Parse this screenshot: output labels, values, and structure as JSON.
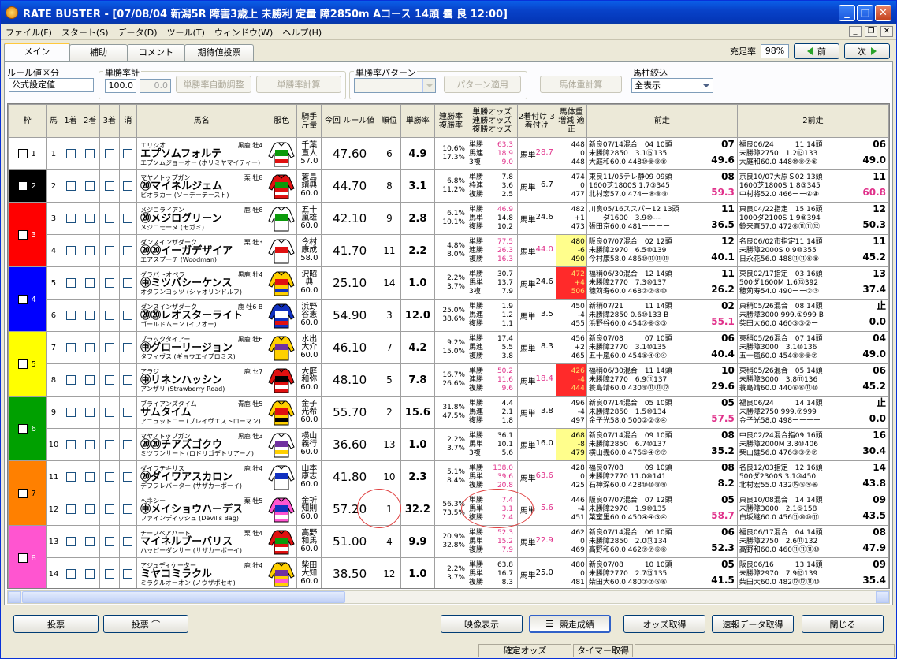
{
  "window": {
    "title": "RATE BUSTER - [07/08/04 新潟5R 障害3歳上 未勝利 定量 障2850m Aコース 14頭 曇 良 12:00]",
    "min": "_",
    "max": "□",
    "close": "✕"
  },
  "menu": [
    "ファイル(F)",
    "スタート(S)",
    "データ(D)",
    "ツール(T)",
    "ウィンドウ(W)",
    "ヘルプ(H)"
  ],
  "tabs": [
    "メイン",
    "補助",
    "コメント",
    "期待値投票"
  ],
  "fill_rate": {
    "label": "充足率",
    "value": "98%"
  },
  "nav": {
    "prev": "前",
    "next": "次"
  },
  "controls": {
    "rule_label": "ルール値区分",
    "rule_value": "公式設定値",
    "winrate_total_label": "単勝率計",
    "winrate_total_value": "100.0",
    "winrate_total_value2": "0.0",
    "auto_adjust": "単勝率自動調整",
    "calc": "単勝率計算",
    "pattern_label": "単勝率パターン",
    "pattern_apply": "パターン適用",
    "weight_calc": "馬体重計算",
    "filter_label": "馬柱絞込",
    "filter_value": "全表示"
  },
  "headers": {
    "waku": "枠",
    "uma": "馬",
    "c1": "1着",
    "c2": "2着",
    "c3": "3着",
    "kesu": "消",
    "name": "馬名",
    "silks": "服色",
    "jockey": "騎手 斤量",
    "rule": "今回 ルール値",
    "rank": "順位",
    "winrate": "単勝率",
    "renrate": "連勝率 複勝率",
    "odds": "単勝オッズ 連勝オッズ 複勝オッズ",
    "ticket": "2着付け 3着付け",
    "body": "馬体重 増減 適正",
    "prev1": "前走",
    "prev2": "2前走"
  },
  "waku_colors": [
    "#ffffff",
    "#000000",
    "#ff0000",
    "#0000ff",
    "#ffff00",
    "#00a000",
    "#ff8000",
    "#ff55d0"
  ],
  "waku_groups": [
    {
      "label": "1",
      "rows": 1,
      "color": "#ffffff",
      "text": "#000000"
    },
    {
      "label": "2",
      "rows": 1,
      "color": "#000000",
      "text": "#ffffff"
    },
    {
      "label": "3",
      "rows": 2,
      "color": "#ff0000",
      "text": "#ffffff"
    },
    {
      "label": "4",
      "rows": 2,
      "color": "#0000ff",
      "text": "#ffffff"
    },
    {
      "label": "5",
      "rows": 2,
      "color": "#ffff00",
      "text": "#000000"
    },
    {
      "label": "6",
      "rows": 2,
      "color": "#00a000",
      "text": "#ffffff"
    },
    {
      "label": "7",
      "rows": 2,
      "color": "#ff8000",
      "text": "#000000"
    },
    {
      "label": "8",
      "rows": 2,
      "color": "#ff55d0",
      "text": "#ffffff"
    }
  ],
  "horses": [
    {
      "no": "1",
      "sire": "エリシオ",
      "meta": "黒鹿 牡4",
      "name": "エプソムフォルテ",
      "dam": "エプソムジョーオー (ホリミヤマイティー)",
      "jockey": [
        "千葉",
        "直人",
        "57.0"
      ],
      "rule": "47.60",
      "rank": "6",
      "winrate": "4.9",
      "rate": [
        "10.6%",
        "17.3%",
        ""
      ],
      "odds": [
        [
          "単勝",
          "63.3"
        ],
        [
          "馬連",
          "18.9"
        ],
        [
          "3複",
          "9.0"
        ]
      ],
      "odds_colors": [
        "#e0308a",
        "#e0308a",
        "#e0308a"
      ],
      "ticket": "馬単",
      "ticket_val": "28.7",
      "ticket_pink": true,
      "body": [
        "448",
        "0",
        "448"
      ],
      "body_style": "",
      "silk": [
        "#ffffff",
        "#0a9a0a",
        "#e01010"
      ],
      "p1": [
        "新良07/14混合　04 10頭",
        "未勝障2850　3.1⑮135",
        "大庭和60.0 448⑩⑨⑨⑧"
      ],
      "p1r": [
        "07",
        "49.6"
      ],
      "p2": [
        "福良06/24　　　11 14頭",
        "未勝障2750　1.2⑬133",
        "大庭和60.0 448⑩⑨⑦⑥"
      ],
      "p2r": [
        "06",
        "49.0"
      ]
    },
    {
      "no": "2",
      "sire": "マヤノトップガン",
      "meta": "栗 牡8",
      "name": "⑳マイネルジェム",
      "dam": "ビオラカー (ソーデーテースト)",
      "jockey": [
        "蓑島",
        "靖典",
        "60.0"
      ],
      "rule": "44.70",
      "rank": "8",
      "winrate": "3.1",
      "rate": [
        "6.8%",
        "11.2%",
        ""
      ],
      "odds": [
        [
          "単勝",
          "7.8"
        ],
        [
          "枠連",
          "3.6"
        ],
        [
          "複勝",
          "2.5"
        ]
      ],
      "odds_colors": [
        "",
        "",
        ""
      ],
      "ticket": "馬単",
      "ticket_val": "6.7",
      "ticket_pink": false,
      "body": [
        "474",
        "0",
        "477"
      ],
      "body_style": "",
      "silk": [
        "#e01010",
        "#0a9a0a",
        "#ffffff"
      ],
      "p1": [
        "東良11/05テレ静09 09頭",
        "1600芝1800S 1.7③345",
        "北村宏57.0 474ー⑧⑨⑨"
      ],
      "p1r": [
        "08",
        "59.3"
      ],
      "p2": [
        "京良10/07大原Ｓ02 13頭",
        "1600芝1800S 1.8③345",
        "中村将52.0 466ーー④④"
      ],
      "p2r": [
        "11",
        "60.8"
      ]
    },
    {
      "no": "3",
      "sire": "メジロライアン",
      "meta": "鹿 牡8",
      "name": "⑳メジログリーン",
      "dam": "メジロモーヌ (モガミ)",
      "jockey": [
        "五十",
        "嵐雄",
        "60.0"
      ],
      "rule": "42.10",
      "rank": "9",
      "winrate": "2.8",
      "rate": [
        "6.1%",
        "10.1%",
        ""
      ],
      "odds": [
        [
          "単勝",
          "46.9"
        ],
        [
          "馬単",
          "14.8"
        ],
        [
          "複勝",
          "10.2"
        ]
      ],
      "odds_colors": [
        "#e0308a",
        "",
        ""
      ],
      "ticket": "馬単",
      "ticket_val": "24.6",
      "ticket_pink": false,
      "body": [
        "482",
        "+1",
        "473"
      ],
      "body_style": "",
      "silk": [
        "#ffffff",
        "#0a9a0a",
        "#ffffff"
      ],
      "p1": [
        "川良05/16ススパー12 13頭",
        "　　ダ1600　3.9⑩---",
        "張田京60.0 481ーーーー"
      ],
      "p1r": [
        "11",
        "36.5"
      ],
      "p2": [
        "東良04/22指定　15 16頭",
        "1000ダ2100S 1.9⑧394",
        "鈴来直57.0 472⑥⑪⑪⑫"
      ],
      "p2r": [
        "12",
        "50.3"
      ]
    },
    {
      "no": "4",
      "sire": "ダンスインザダーク",
      "meta": "栗 牡3",
      "name": "⑳⑳イーガデザイア",
      "dam": "エアスプーチ (Woodman)",
      "jockey": [
        "今村",
        "康成",
        "58.0"
      ],
      "rule": "41.70",
      "rank": "11",
      "winrate": "2.2",
      "rate": [
        "4.8%",
        "8.0%",
        ""
      ],
      "odds": [
        [
          "単勝",
          "77.5"
        ],
        [
          "連勝",
          "26.3"
        ],
        [
          "複勝",
          "16.3"
        ]
      ],
      "odds_colors": [
        "#e0308a",
        "#e0308a",
        "#e0308a"
      ],
      "ticket": "馬単",
      "ticket_val": "44.0",
      "ticket_pink": true,
      "body": [
        "480",
        "-6",
        "490"
      ],
      "body_style": "yel",
      "silk": [
        "#ffffff",
        "#e01010",
        "#ffffff"
      ],
      "p1": [
        "阪良07/07混合　02 12頭",
        "未勝障2970　6.5⑩139",
        "今村康58.0 486⑩⑪⑪⑪"
      ],
      "p1r": [
        "12",
        "40.1"
      ],
      "p2": [
        "名良06/02市指定11 14頭",
        "未勝障2000S 0.9⑩355",
        "日永花56.0 488⑪⑪⑥⑧"
      ],
      "p2r": [
        "11",
        "45.2"
      ]
    },
    {
      "no": "5",
      "sire": "グラバトオペラ",
      "meta": "黒鹿 牡4",
      "name": "㊥ミツバシーケンス",
      "dam": "オタワンヨッツ (シャオリンドルフ)",
      "jockey": [
        "沢昭",
        "典",
        "60.0"
      ],
      "rule": "25.10",
      "rank": "14",
      "winrate": "1.0",
      "rate": [
        "2.2%",
        "3.7%",
        ""
      ],
      "odds": [
        [
          "単勝",
          "30.7"
        ],
        [
          "馬単",
          "13.7"
        ],
        [
          "3複",
          "7.9"
        ]
      ],
      "odds_colors": [
        "",
        "",
        ""
      ],
      "ticket": "馬単",
      "ticket_val": "24.6",
      "ticket_pink": false,
      "body": [
        "472",
        "+4",
        "506"
      ],
      "body_style": "red",
      "silk": [
        "#ffd000",
        "#e01010",
        "#1030c0"
      ],
      "p1": [
        "福稍06/30混合　12 14頭",
        "未勝障2770　7.3⑩137",
        "穂苅寿60.0 468②②⑧⑩"
      ],
      "p1r": [
        "11",
        "26.2"
      ],
      "p2": [
        "東良02/17指定　03 16頭",
        "500ダ1600M 1.6⑬392",
        "穂苅寿54.0 490ーー②③"
      ],
      "p2r": [
        "13",
        "37.4"
      ]
    },
    {
      "no": "6",
      "sire": "ダンスインザダーク",
      "meta": "鹿 牡6 B",
      "name": "⑳⑳レオスターライト",
      "dam": "ゴールドムーン (イフオー)",
      "jockey": [
        "浜野",
        "谷憲",
        "60.0"
      ],
      "rule": "54.90",
      "rank": "3",
      "winrate": "12.0",
      "rate": [
        "25.0%",
        "38.6%",
        ""
      ],
      "odds": [
        [
          "単勝",
          "1.9"
        ],
        [
          "馬連",
          "1.2"
        ],
        [
          "複勝",
          "1.1"
        ]
      ],
      "odds_colors": [
        "",
        "",
        ""
      ],
      "ticket": "馬単",
      "ticket_val": "3.5",
      "ticket_pink": false,
      "body": [
        "450",
        "-4",
        "455"
      ],
      "body_style": "",
      "silk": [
        "#1030c0",
        "#ffffff",
        "#e01010"
      ],
      "p1": [
        "新稍07/21　　　11 14頭",
        "未勝障2850 0.6⑩133 B",
        "浜野谷60.0 454⑦⑥⑤③"
      ],
      "p1r": [
        "02",
        "55.1"
      ],
      "p2": [
        "東稍05/26混合　08 14頭",
        "未勝障3000 999.①999 B",
        "柴田大60.0 460③③②ー"
      ],
      "p2r": [
        "止",
        "0.0"
      ]
    },
    {
      "no": "7",
      "sire": "ブラックタイアー",
      "meta": "黒鹿 牡6",
      "name": "㊥グローリージョン",
      "dam": "タフィヴス (ギョウエイプロミス)",
      "jockey": [
        "水出",
        "大介",
        "60.0"
      ],
      "rule": "46.10",
      "rank": "7",
      "winrate": "4.2",
      "rate": [
        "9.2%",
        "15.0%",
        ""
      ],
      "odds": [
        [
          "単勝",
          "17.4"
        ],
        [
          "馬連",
          "5.5"
        ],
        [
          "複勝",
          "3.8"
        ]
      ],
      "odds_colors": [
        "",
        "",
        ""
      ],
      "ticket": "馬単",
      "ticket_val": "8.3",
      "ticket_pink": false,
      "body": [
        "456",
        "+2",
        "465"
      ],
      "body_style": "",
      "silk": [
        "#ffd000",
        "#7030a0",
        "#ffd000"
      ],
      "p1": [
        "新良07/08　　　07 10頭",
        "未勝障2770　3.1⑩135",
        "五十嵐60.0 454⑤④④④"
      ],
      "p1r": [
        "06",
        "40.4"
      ],
      "p2": [
        "東稍05/26混合　07 14頭",
        "未勝障3000　3.1⑩136",
        "五十嵐60.0 454⑧⑨⑨⑦"
      ],
      "p2r": [
        "04",
        "49.0"
      ]
    },
    {
      "no": "8",
      "sire": "アラジ",
      "meta": "鹿 セ7",
      "name": "㊥リネンハッシン",
      "dam": "アンザリ (Strawberry Road)",
      "jockey": [
        "大庭",
        "和弥",
        "60.0"
      ],
      "rule": "48.10",
      "rank": "5",
      "winrate": "7.8",
      "rate": [
        "16.7%",
        "26.6%",
        ""
      ],
      "odds": [
        [
          "単勝",
          "50.2"
        ],
        [
          "連勝",
          "11.6"
        ],
        [
          "複勝",
          "9.6"
        ]
      ],
      "odds_colors": [
        "#e0308a",
        "#e0308a",
        "#e0308a"
      ],
      "ticket": "馬単",
      "ticket_val": "18.4",
      "ticket_pink": true,
      "body": [
        "426",
        "-4",
        "444"
      ],
      "body_style": "red",
      "silk": [
        "#e01010",
        "#000000",
        "#ffffff"
      ],
      "p1": [
        "福稍06/30混合　11 14頭",
        "未勝障2770　6.9⑪137",
        "蓑島靖60.0 430⑨⑪⑪⑫"
      ],
      "p1r": [
        "10",
        "29.6"
      ],
      "p2": [
        "東稍05/26混合　05 14頭",
        "未勝障3000　3.8⑪136",
        "蓑島靖60.0 440⑥⑥⑪⑩"
      ],
      "p2r": [
        "06",
        "45.2"
      ]
    },
    {
      "no": "9",
      "sire": "ブライアンズタイム",
      "meta": "青鹿 牡5",
      "name": "サムタイム",
      "dam": "アニュットロー (プレイヴエストローマン)",
      "jockey": [
        "金子",
        "光希",
        "60.0"
      ],
      "rule": "55.70",
      "rank": "2",
      "winrate": "15.6",
      "rate": [
        "31.8%",
        "47.5%",
        ""
      ],
      "odds": [
        [
          "単勝",
          "4.4"
        ],
        [
          "馬連",
          "2.1"
        ],
        [
          "複勝",
          "1.8"
        ]
      ],
      "odds_colors": [
        "",
        "",
        ""
      ],
      "ticket": "馬単",
      "ticket_val": "3.8",
      "ticket_pink": false,
      "body": [
        "496",
        "-4",
        "497"
      ],
      "body_style": "",
      "silk": [
        "#ffd000",
        "#e01010",
        "#000000"
      ],
      "p1": [
        "新良07/14混合　05 10頭",
        "未勝障2850　1.5⑩134",
        "金子光58.0 500②②⑨④"
      ],
      "p1r": [
        "05",
        "57.5"
      ],
      "p2": [
        "福良06/24　　　14 14頭",
        "未勝障2750 999.⑦999",
        "金子光58.0 498ーーーー"
      ],
      "p2r": [
        "止",
        "0.0"
      ]
    },
    {
      "no": "10",
      "sire": "マヤノトップガン",
      "meta": "黒鹿 牡3",
      "name": "⑳⑳チアズゴクウ",
      "dam": "ミツワンサート (ロドリゴデトリアーノ)",
      "jockey": [
        "横山",
        "義行",
        "60.0"
      ],
      "rule": "36.60",
      "rank": "13",
      "winrate": "1.0",
      "rate": [
        "2.2%",
        "3.7%",
        ""
      ],
      "odds": [
        [
          "単勝",
          "36.1"
        ],
        [
          "馬単",
          "10.1"
        ],
        [
          "3複",
          "5.6"
        ]
      ],
      "odds_colors": [
        "",
        "",
        ""
      ],
      "ticket": "馬単",
      "ticket_val": "16.0",
      "ticket_pink": false,
      "body": [
        "468",
        "-8",
        "479"
      ],
      "body_style": "yel",
      "silk": [
        "#ffffff",
        "#7030a0",
        "#ffd000"
      ],
      "p1": [
        "新良07/14混合　09 10頭",
        "未勝障2850　6.7⑩137",
        "横山義60.0 476⑤④⑦⑦"
      ],
      "p1r": [
        "08",
        "35.2"
      ],
      "p2": [
        "中良02/24混合指09 16頭",
        "未勝障2000M 3.8⑩406",
        "柴山雄56.0 476③③⑦⑦"
      ],
      "p2r": [
        "16",
        "30.4"
      ]
    },
    {
      "no": "11",
      "sire": "ダイワテキサス",
      "meta": "鹿 牡4",
      "name": "⑳ダイワアスカロン",
      "dam": "デフフレバーター (サザカーボーイ)",
      "jockey": [
        "山本",
        "康志",
        "60.0"
      ],
      "rule": "41.80",
      "rank": "10",
      "winrate": "2.3",
      "rate": [
        "5.1%",
        "8.4%",
        ""
      ],
      "odds": [
        [
          "単勝",
          "138.0"
        ],
        [
          "馬単",
          "39.6"
        ],
        [
          "複勝",
          "20.8"
        ]
      ],
      "odds_colors": [
        "#e0308a",
        "#e0308a",
        "#e0308a"
      ],
      "ticket": "馬単",
      "ticket_val": "63.6",
      "ticket_pink": true,
      "body": [
        "428",
        "0",
        "425"
      ],
      "body_style": "",
      "silk": [
        "#ffffff",
        "#1030c0",
        "#ffffff"
      ],
      "p1": [
        "福良07/08　　　09 10頭",
        "未勝障2770 11.0⑩141",
        "石神深60.0 428⑩⑩⑨⑨"
      ],
      "p1r": [
        "08",
        "8.2"
      ],
      "p2": [
        "名良12/03指定　12 16頭",
        "500ダ2300S 3.1⑩450",
        "北村宏55.0 432⑮⑤⑤⑥"
      ],
      "p2r": [
        "14",
        "43.8"
      ]
    },
    {
      "no": "12",
      "sire": "ヘネシー",
      "meta": "栗 牡5",
      "name": "㊥メイショウハーデス",
      "dam": "ファインディッシュ (Devil's Bag)",
      "jockey": [
        "金折",
        "知則",
        "60.0"
      ],
      "rule": "57.20",
      "rank": "1",
      "winrate": "32.2",
      "rate": [
        "56.3%",
        "73.5%",
        ""
      ],
      "odds": [
        [
          "単勝",
          "7.4"
        ],
        [
          "馬単",
          "3.1"
        ],
        [
          "複勝",
          "2.4"
        ]
      ],
      "odds_colors": [
        "#e0308a",
        "#e0308a",
        "#e0308a"
      ],
      "ticket": "馬単",
      "ticket_val": "5.6",
      "ticket_pink": true,
      "body": [
        "446",
        "-4",
        "451"
      ],
      "body_style": "",
      "silk": [
        "#ff55d0",
        "#1030c0",
        "#ffffff"
      ],
      "p1": [
        "阪良07/07混合　07 12頭",
        "未勝障2970　1.9⑩135",
        "菓室里60.0 450④④③④"
      ],
      "p1r": [
        "05",
        "58.7"
      ],
      "p2": [
        "東良10/08混合　14 14頭",
        "未勝障3000　2.1⑤158",
        "白坂継60.0 456⑪⑩⑩⑪"
      ],
      "p2r": [
        "09",
        "43.5"
      ]
    },
    {
      "no": "13",
      "sire": "チーフベアハート",
      "meta": "栗 牡4",
      "name": "マイネルブーバリス",
      "dam": "ハッピーダンサー (サザカーボーイ)",
      "jockey": [
        "高野",
        "和馬",
        "60.0"
      ],
      "rule": "51.00",
      "rank": "4",
      "winrate": "9.9",
      "rate": [
        "20.9%",
        "32.8%",
        ""
      ],
      "odds": [
        [
          "単勝",
          "52.3"
        ],
        [
          "馬単",
          "15.2"
        ],
        [
          "複勝",
          "7.9"
        ]
      ],
      "odds_colors": [
        "#e0308a",
        "#e0308a",
        "#e0308a"
      ],
      "ticket": "馬単",
      "ticket_val": "22.9",
      "ticket_pink": true,
      "body": [
        "462",
        "0",
        "469"
      ],
      "body_style": "",
      "silk": [
        "#e01010",
        "#0a9a0a",
        "#ffffff"
      ],
      "p1": [
        "新良07/14混合　06 10頭",
        "未勝障2850　2.0⑬134",
        "高野和60.0 462⑦⑦⑥⑥"
      ],
      "p1r": [
        "06",
        "52.3"
      ],
      "p2": [
        "福良06/17混合　04 14頭",
        "未勝障2750　2.6⑪132",
        "高野和60.0 460⑪⑪⑪⑩"
      ],
      "p2r": [
        "08",
        "47.9"
      ]
    },
    {
      "no": "14",
      "sire": "アジュディケーター",
      "meta": "鹿 牡4",
      "name": "ミヤコミラクル",
      "dam": "ミラクルオーオン (ノウザボセキ)",
      "jockey": [
        "柴田",
        "大知",
        "60.0"
      ],
      "rule": "38.50",
      "rank": "12",
      "winrate": "1.0",
      "rate": [
        "2.2%",
        "3.7%",
        ""
      ],
      "odds": [
        [
          "単勝",
          "63.8"
        ],
        [
          "馬単",
          "16.7"
        ],
        [
          "複勝",
          "8.3"
        ]
      ],
      "odds_colors": [
        "",
        "",
        ""
      ],
      "ticket": "馬単",
      "ticket_val": "25.0",
      "ticket_pink": false,
      "body": [
        "480",
        "0",
        "481"
      ],
      "body_style": "",
      "silk": [
        "#ffd000",
        "#7030a0",
        "#ff55d0"
      ],
      "p1": [
        "新良07/08　　　10 10頭",
        "未勝障2770　2.7⑬135",
        "柴田大60.0 480⑦⑦⑤⑥"
      ],
      "p1r": [
        "05",
        "41.5"
      ],
      "p2": [
        "阪良06/16　　　13 14頭",
        "未勝障2970　7.9⑬139",
        "柴田大60.0 482⑫⑫⑪⑩"
      ],
      "p2r": [
        "09",
        "35.4"
      ]
    }
  ],
  "bottom": {
    "vote": "投票",
    "vote2": "投票 ⌒",
    "video": "映像表示",
    "results": "競走成績",
    "get_odds": "オッズ取得",
    "flash": "速報データ取得",
    "close": "閉じる"
  },
  "status": {
    "s1": "確定オッズ",
    "s2": "タイマー取得"
  }
}
